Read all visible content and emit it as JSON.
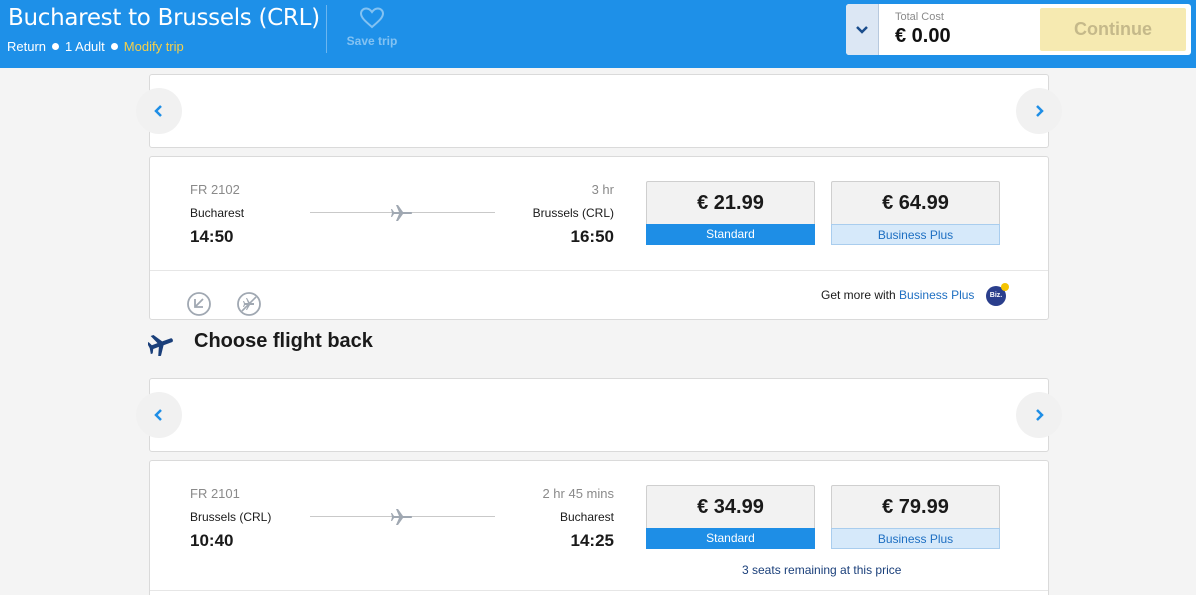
{
  "header": {
    "title": "Bucharest to Brussels (CRL)",
    "trip_type": "Return",
    "passengers": "1 Adult",
    "modify_label": "Modify trip",
    "save_label": "Save trip",
    "total_cost_label": "Total Cost",
    "total_cost_value": "€ 0.00",
    "continue_label": "Continue"
  },
  "outbound": {
    "flight_number": "FR 2102",
    "origin": "Bucharest",
    "destination": "Brussels (CRL)",
    "depart_time": "14:50",
    "arrive_time": "16:50",
    "duration": "3 hr",
    "fares": [
      {
        "price": "€ 21.99",
        "label": "Standard"
      },
      {
        "price": "€ 64.99",
        "label": "Business Plus"
      }
    ],
    "get_more_prefix": "Get more with",
    "get_more_link": "Business Plus",
    "biz_badge": "Biz."
  },
  "return_section": {
    "title": "Choose flight back"
  },
  "inbound": {
    "flight_number": "FR 2101",
    "origin": "Brussels (CRL)",
    "destination": "Bucharest",
    "depart_time": "10:40",
    "arrive_time": "14:25",
    "duration": "2 hr 45 mins",
    "fares": [
      {
        "price": "€ 34.99",
        "label": "Standard"
      },
      {
        "price": "€ 79.99",
        "label": "Business Plus"
      }
    ],
    "seats_remaining": "3 seats remaining at this price"
  },
  "colors": {
    "brand_blue": "#1e90e8",
    "standard_tag": "#1e8ee6",
    "continue_disabled": "#f6eab1",
    "modify_link": "#f5d04a"
  },
  "icons": [
    "heart-icon",
    "chevron-down-icon",
    "chevron-left-icon",
    "chevron-right-icon",
    "plane-icon",
    "lounge-icon",
    "no-flight-icon"
  ]
}
